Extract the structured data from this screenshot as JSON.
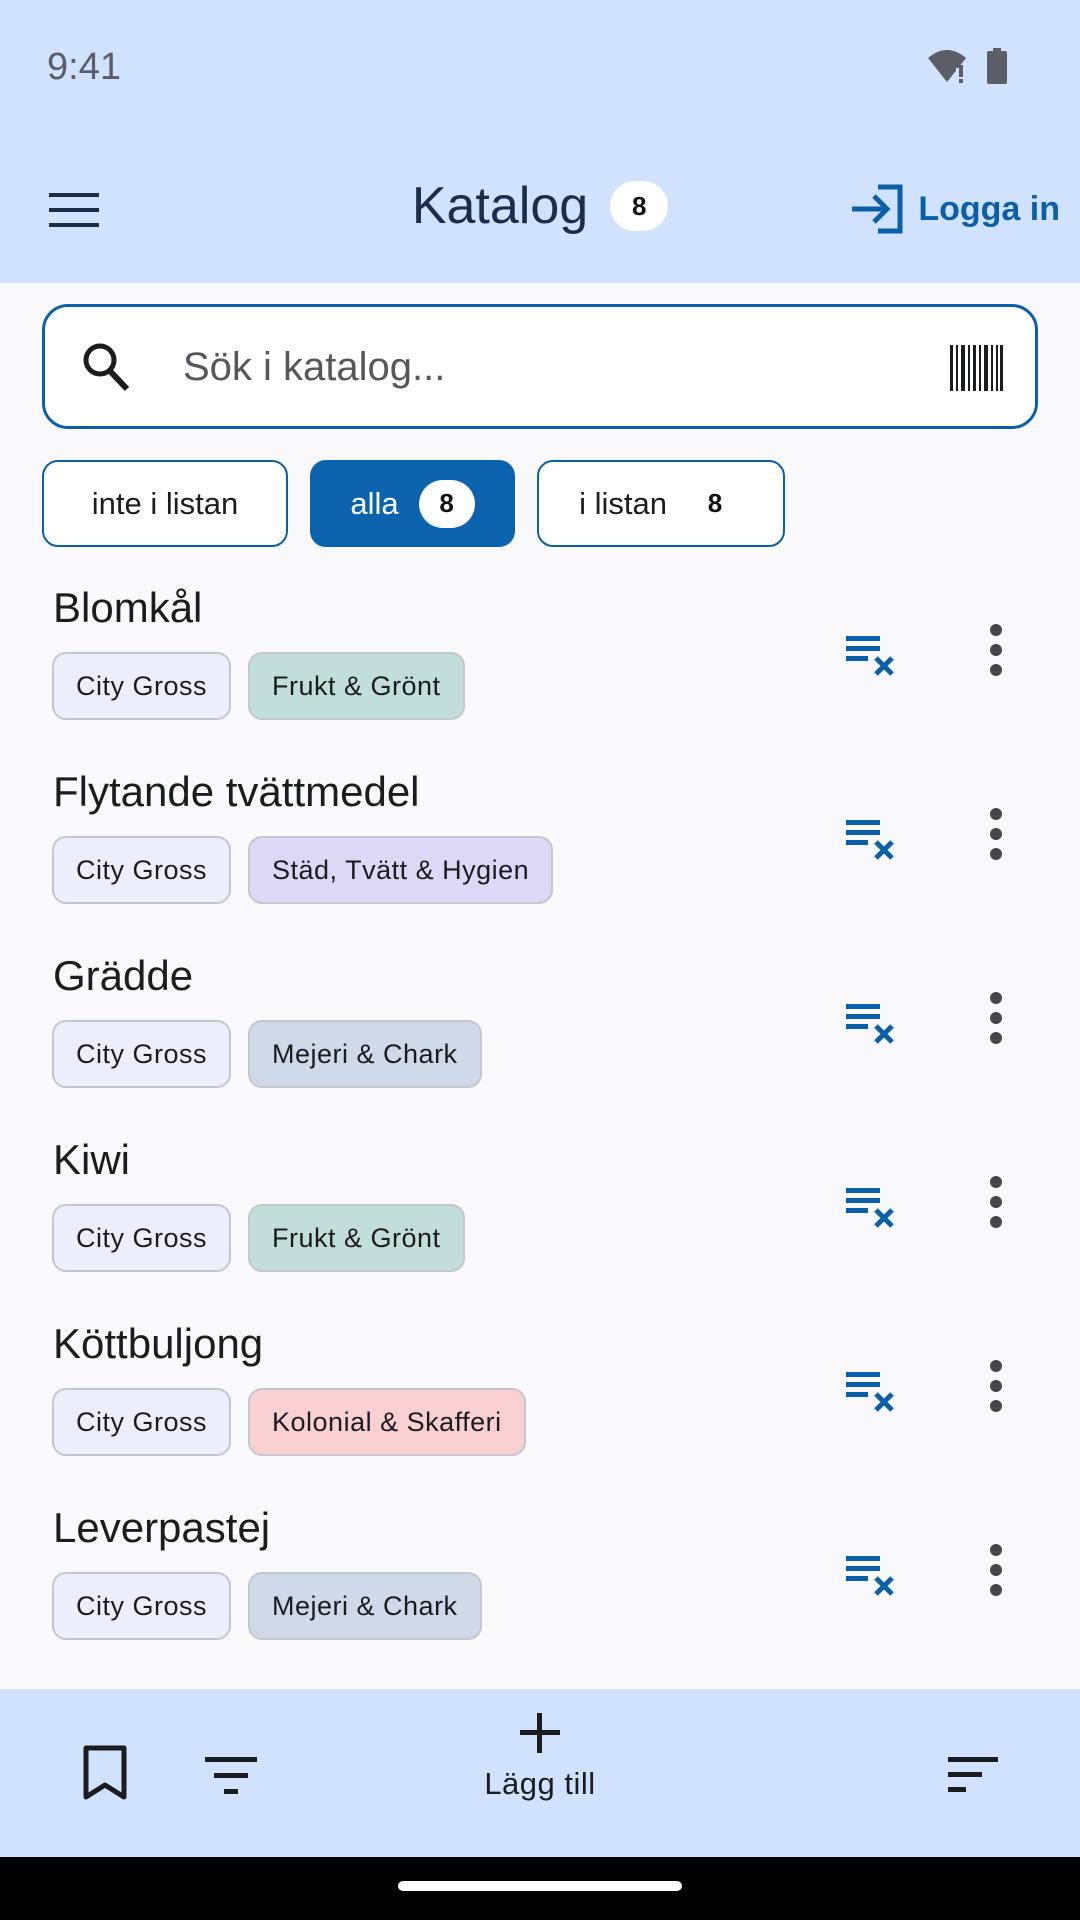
{
  "status_bar": {
    "time": "9:41"
  },
  "app_bar": {
    "title": "Katalog",
    "count": "8",
    "login_label": "Logga in"
  },
  "search": {
    "placeholder": "Sök i katalog..."
  },
  "filter_chips": [
    {
      "label": "inte i listan",
      "count": ""
    },
    {
      "label": "alla",
      "count": "8"
    },
    {
      "label": "i listan",
      "count": "8"
    }
  ],
  "tag_colors": {
    "store": "#eceefc",
    "Frukt & Grönt": "#c1dedb",
    "Städ, Tvätt & Hygien": "#dcd8f5",
    "Mejeri & Chark": "#d0d9e9",
    "Kolonial & Skafferi": "#f9d0d2"
  },
  "items": [
    {
      "name": "Blomkål",
      "store": "City Gross",
      "category": "Frukt & Grönt"
    },
    {
      "name": "Flytande tvättmedel",
      "store": "City Gross",
      "category": "Städ, Tvätt & Hygien"
    },
    {
      "name": "Grädde",
      "store": "City Gross",
      "category": "Mejeri & Chark"
    },
    {
      "name": "Kiwi",
      "store": "City Gross",
      "category": "Frukt & Grönt"
    },
    {
      "name": "Köttbuljong",
      "store": "City Gross",
      "category": "Kolonial & Skafferi"
    },
    {
      "name": "Leverpastej",
      "store": "City Gross",
      "category": "Mejeri & Chark"
    }
  ],
  "bottom_bar": {
    "add_label": "Lägg till"
  },
  "icons": {
    "menu": "menu-icon",
    "login": "login-icon",
    "search": "search-icon",
    "barcode": "barcode-icon",
    "remove_from_list": "playlist-remove-icon",
    "more": "more-vert-icon",
    "bookmark": "bookmark-icon",
    "filter": "filter-icon",
    "add": "plus-icon",
    "sort": "sort-icon"
  }
}
